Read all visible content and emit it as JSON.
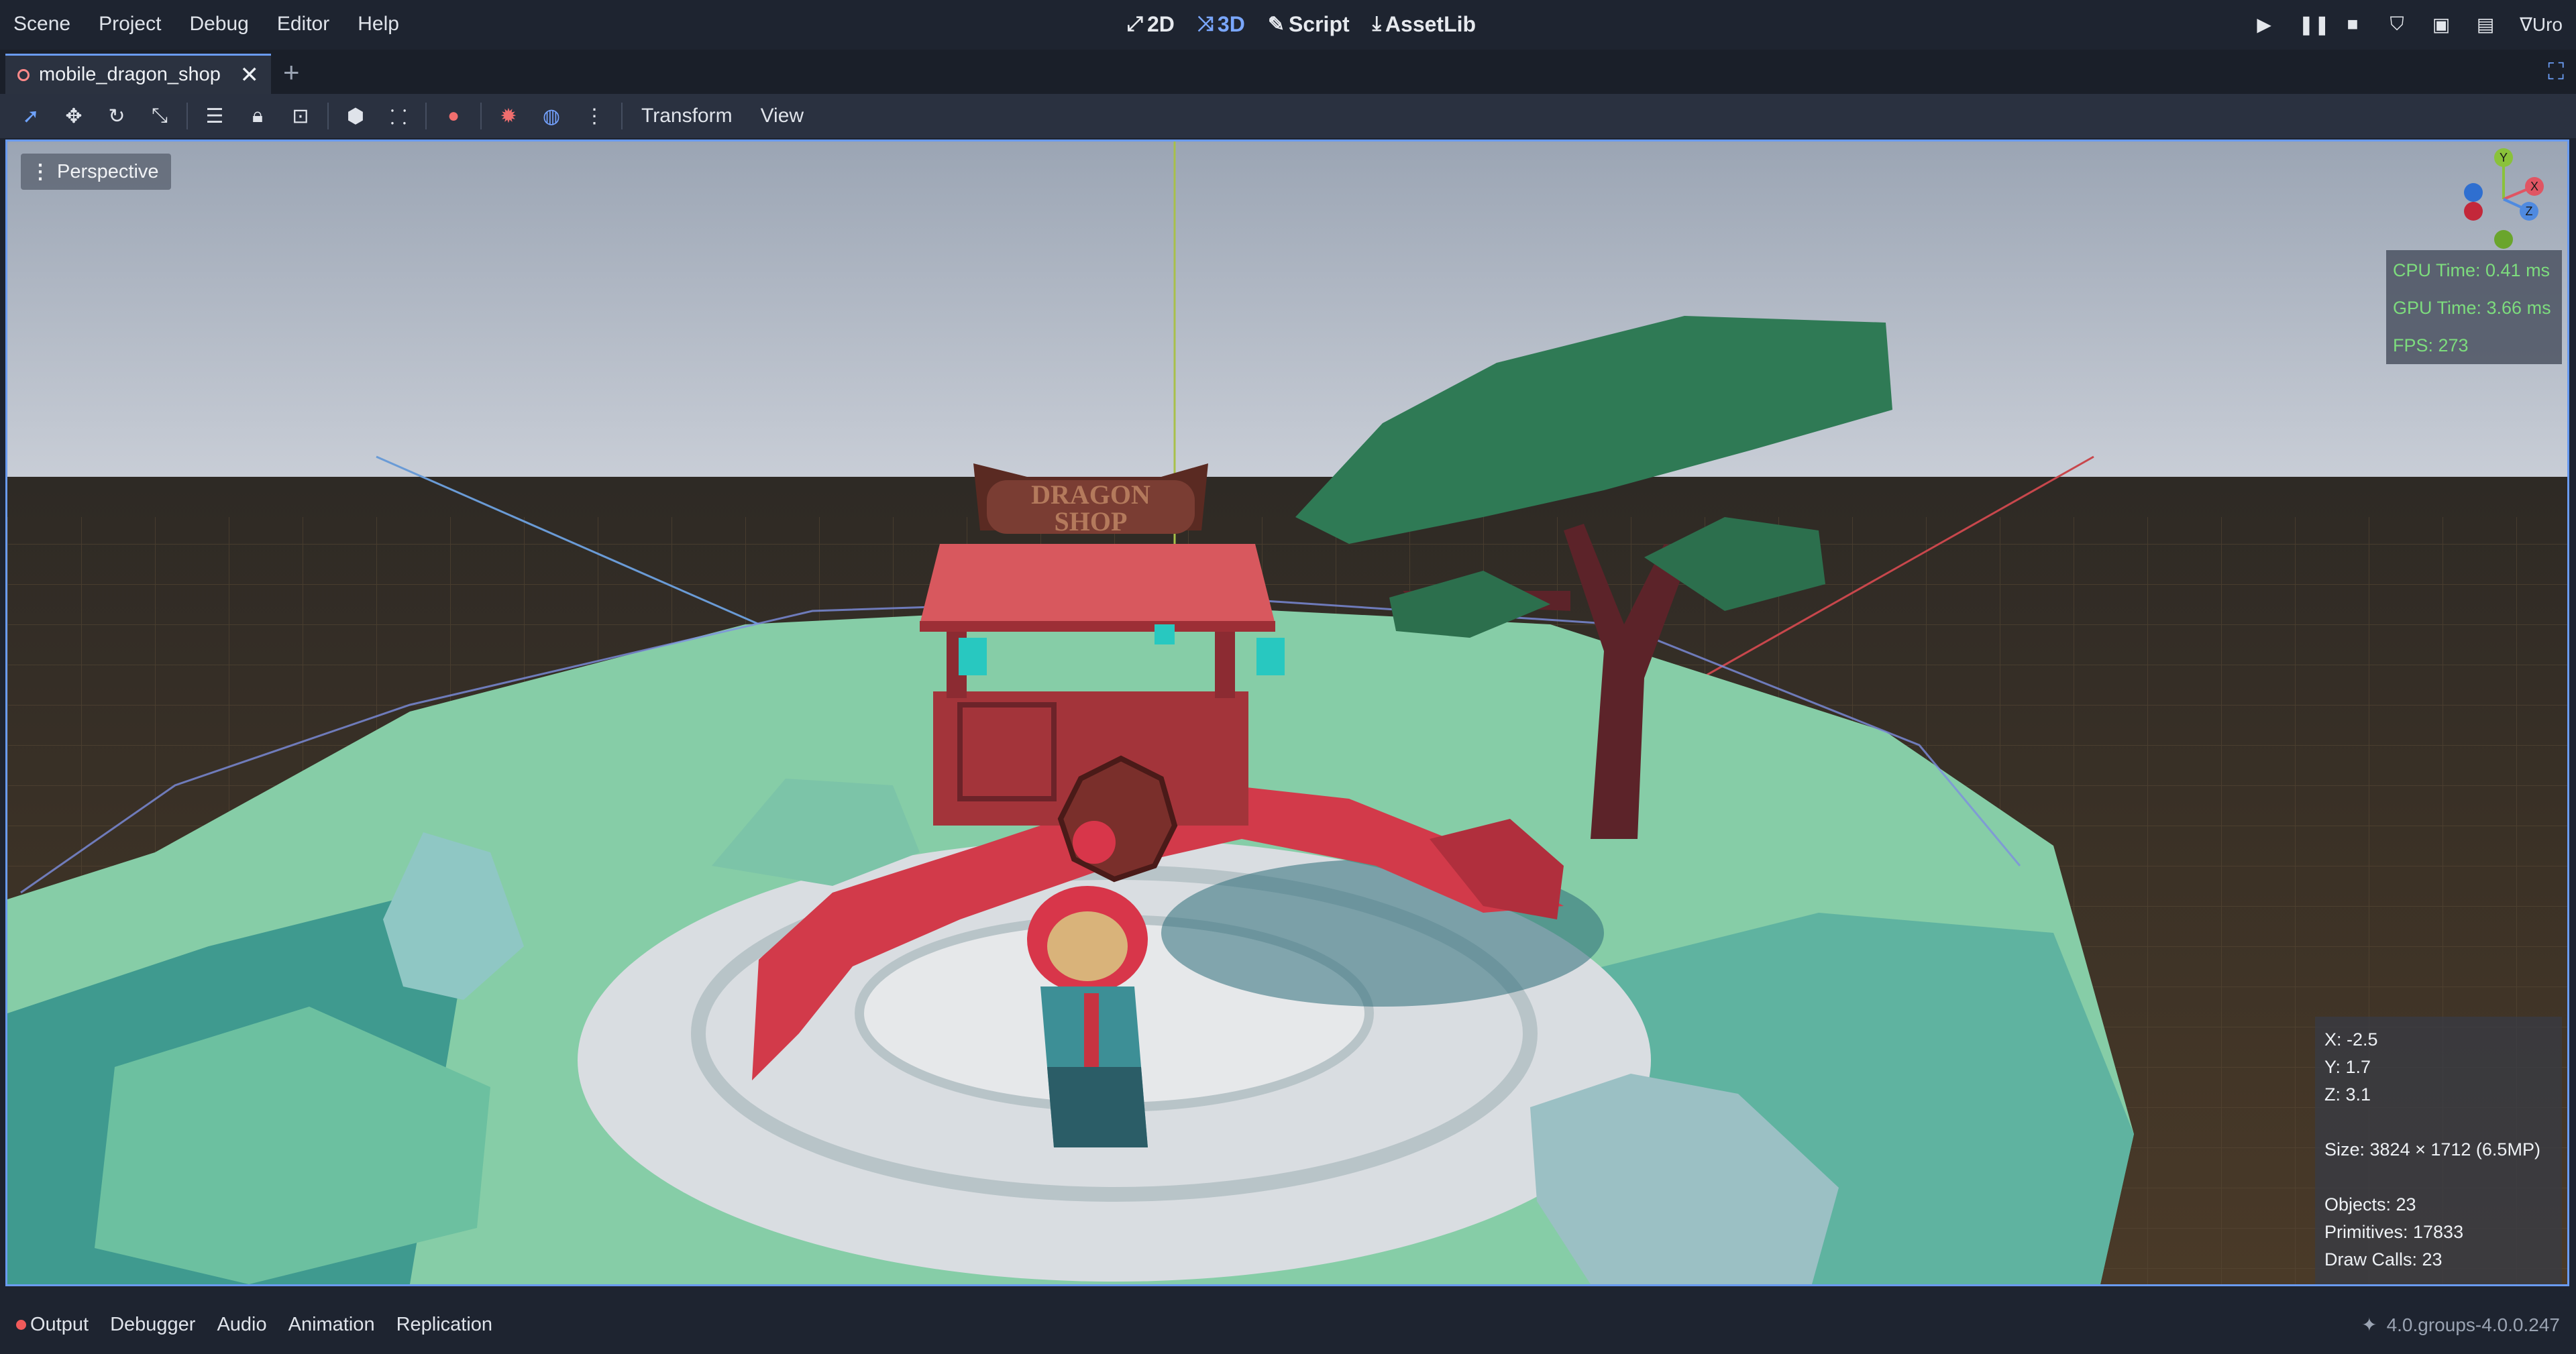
{
  "menubar": {
    "items": [
      "Scene",
      "Project",
      "Debug",
      "Editor",
      "Help"
    ],
    "workspaces": [
      {
        "label": "2D",
        "icon": "2d-icon"
      },
      {
        "label": "3D",
        "icon": "3d-icon",
        "active": true
      },
      {
        "label": "Script",
        "icon": "script-icon"
      },
      {
        "label": "AssetLib",
        "icon": "assetlib-icon"
      }
    ],
    "renderer": "Uro"
  },
  "tabs": {
    "scene_tab": "mobile_dragon_shop",
    "add_tab": "+"
  },
  "toolbar": {
    "transform_menu": "Transform",
    "view_menu": "View"
  },
  "viewport": {
    "perspective_label": "Perspective",
    "gizmo_axes": {
      "y": "Y",
      "x": "X",
      "z": "Z"
    },
    "performance": {
      "cpu_time": "CPU Time: 0.41 ms",
      "gpu_time": "GPU Time: 3.66 ms",
      "fps": "FPS: 273"
    },
    "info": {
      "x": "X: -2.5",
      "y": "Y: 1.7",
      "z": "Z: 3.1",
      "size": "Size: 3824 × 1712 (6.5MP)",
      "objects": "Objects: 23",
      "primitives": "Primitives: 17833",
      "draw_calls": "Draw Calls: 23"
    },
    "sign_text": [
      "DRAGON",
      "SHOP"
    ]
  },
  "bottom_tabs": [
    "Output",
    "Debugger",
    "Audio",
    "Animation",
    "Replication"
  ],
  "version": "4.0.groups-4.0.0.247",
  "colors": {
    "accent": "#6a9bf0",
    "fps_green": "#7ddc7d",
    "dragon_red": "#d23a4a",
    "island_mint": "#8fd3ad"
  }
}
